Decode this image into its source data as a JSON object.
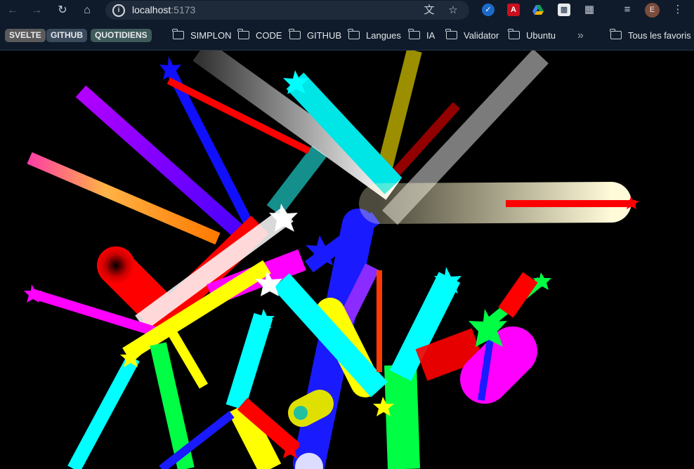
{
  "browser": {
    "url_host": "localhost",
    "url_port": ":5173",
    "profile_initial": "E"
  },
  "bookmarks": {
    "pills": [
      {
        "label": "SVELTE",
        "bg": "#5a5a5a"
      },
      {
        "label": "GITHUB",
        "bg": "#3b4b5c"
      },
      {
        "label": "QUOTIDIENS",
        "bg": "#3f5a5a"
      }
    ],
    "folders": [
      "SIMPLON",
      "CODE",
      "GITHUB",
      "Langues",
      "IA",
      "Validator",
      "Ubuntu"
    ],
    "overflow_label": "»",
    "all_bookmarks_label": "Tous les favoris"
  },
  "icons": {
    "back": "arrow-left-icon",
    "forward": "arrow-right-icon",
    "reload": "reload-icon",
    "home": "home-icon",
    "translate": "translate-icon",
    "star": "star-icon",
    "extensions": "puzzle-icon",
    "reading_list": "reading-list-icon",
    "menu": "kebab-menu-icon"
  }
}
